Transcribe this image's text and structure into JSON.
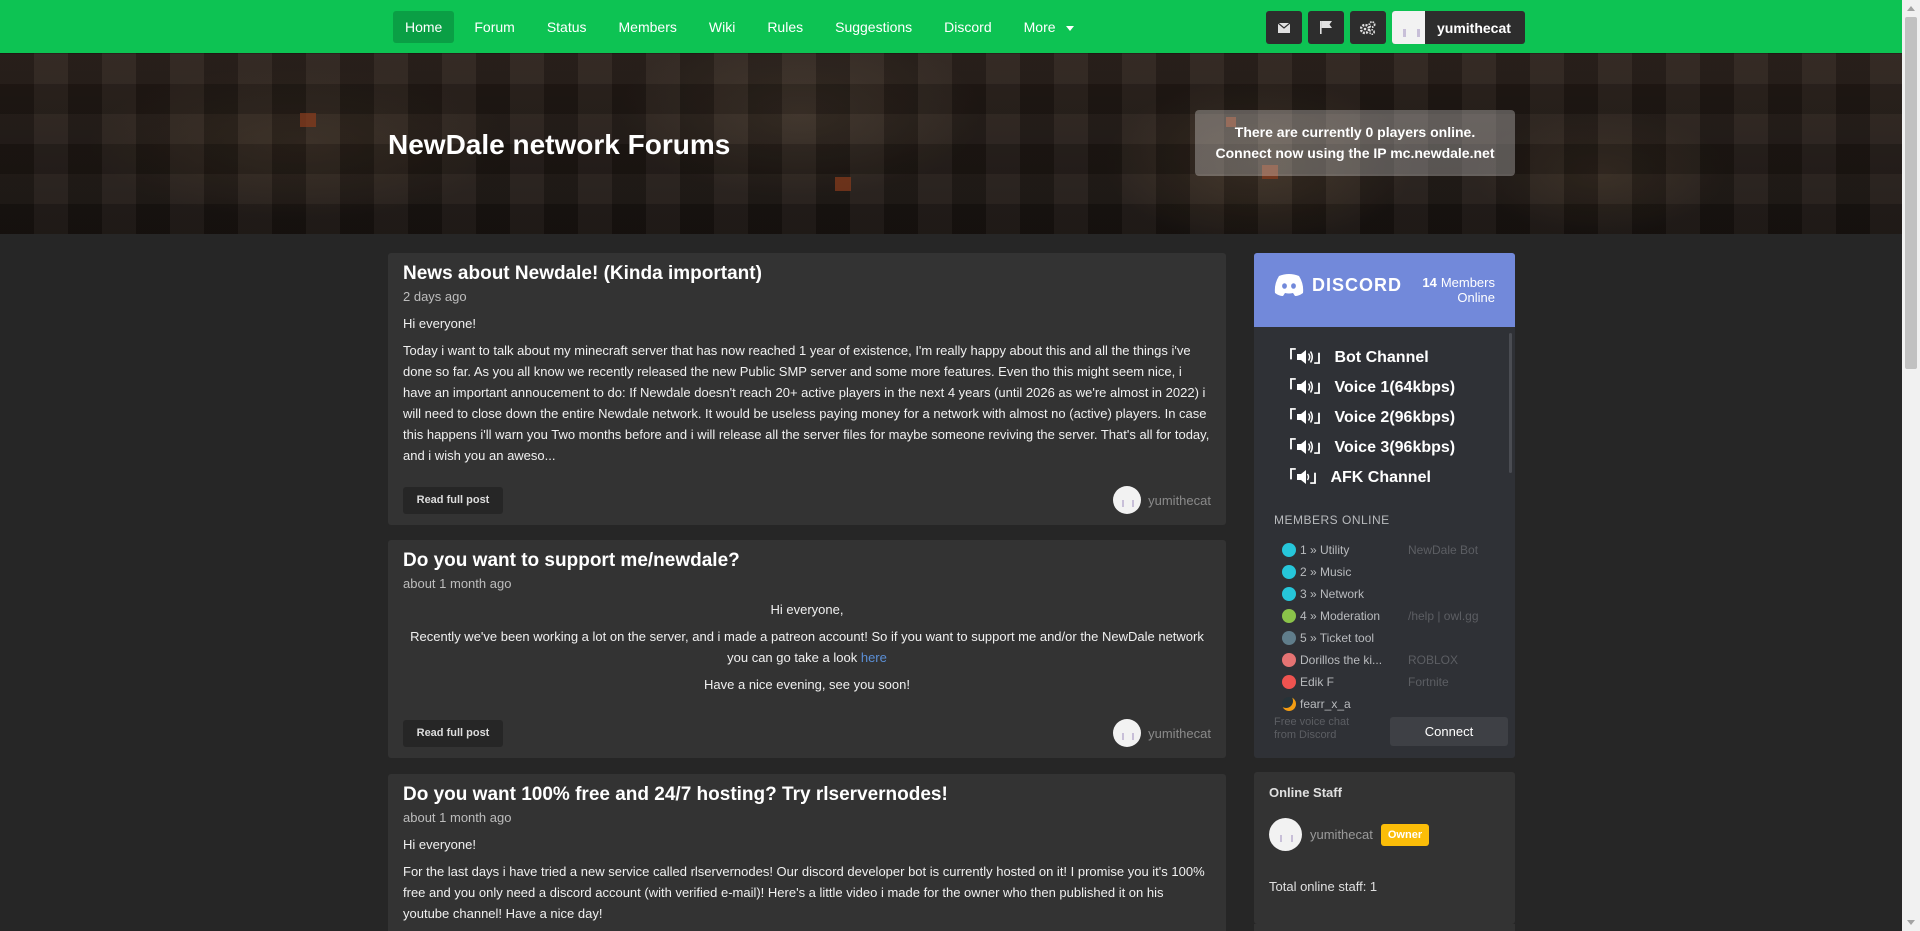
{
  "nav": {
    "items": [
      {
        "label": "Home",
        "active": true
      },
      {
        "label": "Forum"
      },
      {
        "label": "Status"
      },
      {
        "label": "Members"
      },
      {
        "label": "Wiki"
      },
      {
        "label": "Rules"
      },
      {
        "label": "Suggestions"
      },
      {
        "label": "Discord"
      },
      {
        "label": "More"
      }
    ],
    "icons": [
      "envelope-icon",
      "flag-icon",
      "cogs-icon"
    ],
    "username": "yumithecat"
  },
  "banner": {
    "title": "NewDale network Forums",
    "players_line1": "There are currently 0 players online.",
    "players_line2": "Connect now using the IP mc.newdale.net"
  },
  "posts": [
    {
      "title": "News about Newdale! (Kinda important)",
      "date": "2 days ago",
      "greeting": "Hi everyone!",
      "body": "Today i want to talk about my minecraft server that has now reached 1 year of existence, I'm really happy about this and all the things i've done so far. As you all know we recently released the new Public SMP server and some more features. Even tho this might seem nice, i have an important annoucement to do: If Newdale doesn't reach 20+ active players in the next 4 years (until 2026 as we're almost in 2022) i will need to close down the entire Newdale network. It would be useless paying money for a network with almost no (active) players. In case this happens i'll warn you Two months before and i will release all the server files for maybe someone reviving the server. That's all for today, and i wish you an aweso...",
      "read_label": "Read full post",
      "author": "yumithecat"
    },
    {
      "title": "Do you want to support me/newdale?",
      "date": "about 1 month ago",
      "greeting": "Hi everyone,",
      "body": "Recently we've been working a lot on the server, and i made a patreon account! So if you want to support me and/or the NewDale network you can go take a look",
      "link": "here",
      "closing": "Have a nice evening, see you soon!",
      "read_label": "Read full post",
      "author": "yumithecat"
    },
    {
      "title": "Do you want 100% free and 24/7 hosting? Try rlservernodes!",
      "date": "about 1 month ago",
      "greeting": "Hi everyone!",
      "body": "For the last days i have tried a new service called rlservernodes! Our discord developer bot is currently hosted on it! I promise you it's 100% free and you only need a discord account (with verified e-mail)! Here's a little video i made for the owner who then published it on his youtube channel! Have a nice day!"
    }
  ],
  "discord": {
    "logo_text": "DISCORD",
    "members_count": "14",
    "members_label": "Members",
    "online_label": "Online",
    "channels": [
      "Bot Channel",
      "Voice 1(64kbps)",
      "Voice 2(96kbps)",
      "Voice 3(96kbps)",
      "AFK Channel"
    ],
    "members_heading": "MEMBERS ONLINE",
    "members": [
      {
        "name": "1 » Utility",
        "game": "NewDale Bot",
        "color": "#26c6da"
      },
      {
        "name": "2 » Music",
        "game": "",
        "color": "#26c6da"
      },
      {
        "name": "3 » Network",
        "game": "",
        "color": "#26c6da"
      },
      {
        "name": "4 » Moderation",
        "game": "/help | owl.gg",
        "color": "#8bc34a"
      },
      {
        "name": "5 » Ticket tool",
        "game": "",
        "color": "#607d8b"
      },
      {
        "name": "Dorillos the ki...",
        "game": "ROBLOX",
        "color": "#e57373"
      },
      {
        "name": "Edik F",
        "game": "Fortnite",
        "color": "#ef5350"
      },
      {
        "name": "fearr_x_a",
        "game": "",
        "color": "#263238"
      }
    ],
    "footer": "Free voice chat from Discord",
    "connect_label": "Connect"
  },
  "staff": {
    "title": "Online Staff",
    "user": "yumithecat",
    "badge": "Owner",
    "total": "Total online staff: 1"
  }
}
